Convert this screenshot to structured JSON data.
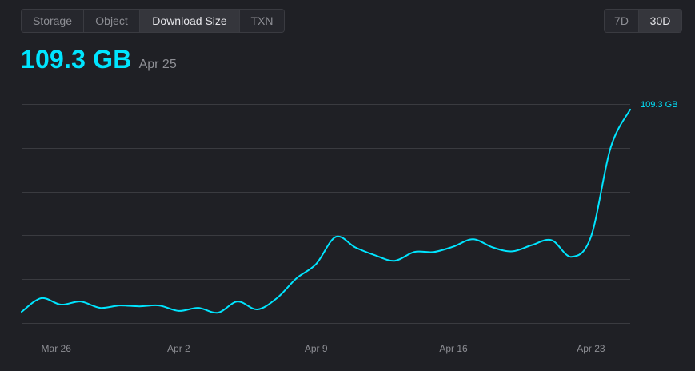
{
  "tabs": {
    "metrics": [
      {
        "label": "Storage",
        "active": false
      },
      {
        "label": "Object",
        "active": false
      },
      {
        "label": "Download Size",
        "active": true
      },
      {
        "label": "TXN",
        "active": false
      }
    ],
    "ranges": [
      {
        "label": "7D",
        "active": false
      },
      {
        "label": "30D",
        "active": true
      }
    ]
  },
  "headline": {
    "value": "109.3 GB",
    "date": "Apr 25"
  },
  "colors": {
    "accent": "#00e5ff",
    "background": "#1f2025",
    "grid": "#3a3b40",
    "muted_text": "#8d8e94",
    "active_text": "#e6e6ea"
  },
  "chart_data": {
    "type": "line",
    "x_ticks": [
      "Mar 26",
      "Apr 2",
      "Apr 9",
      "Apr 16",
      "Apr 23"
    ],
    "last_value_label": "109.3 GB",
    "grid": "horizontal",
    "y_gridlines": [
      0,
      20,
      40,
      60,
      80,
      100
    ],
    "ylim": [
      0,
      100
    ],
    "x": [
      "Mar 25",
      "Mar 26",
      "Mar 27",
      "Mar 28",
      "Mar 29",
      "Mar 30",
      "Mar 31",
      "Apr 1",
      "Apr 2",
      "Apr 3",
      "Apr 4",
      "Apr 5",
      "Apr 6",
      "Apr 7",
      "Apr 8",
      "Apr 9",
      "Apr 10",
      "Apr 11",
      "Apr 12",
      "Apr 13",
      "Apr 14",
      "Apr 15",
      "Apr 16",
      "Apr 17",
      "Apr 18",
      "Apr 19",
      "Apr 20",
      "Apr 21",
      "Apr 22",
      "Apr 23",
      "Apr 24",
      "Apr 25"
    ],
    "series": [
      {
        "values": [
          5.1,
          11.3,
          8.4,
          9.8,
          6.9,
          8.0,
          7.6,
          8.0,
          5.5,
          6.9,
          4.7,
          9.8,
          6.2,
          11.3,
          20.4,
          26.9,
          39.3,
          34.5,
          30.9,
          28.4,
          32.4,
          32.4,
          34.9,
          38.2,
          34.5,
          32.7,
          35.6,
          37.8,
          30.2,
          39.3,
          80.0,
          97.5
        ]
      }
    ]
  }
}
